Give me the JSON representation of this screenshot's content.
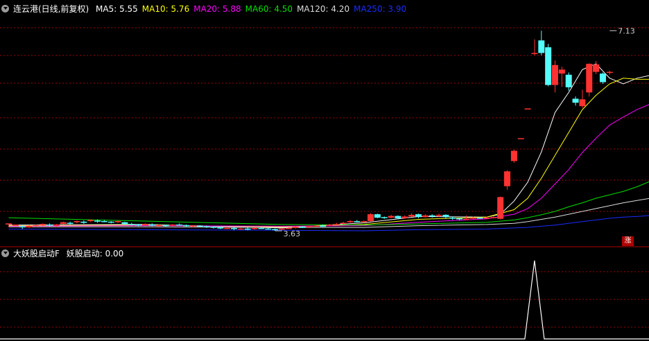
{
  "main_header": {
    "title": "连云港(日线,前复权)",
    "ma": [
      {
        "label": "MA5: 5.55",
        "color": "#ffffff"
      },
      {
        "label": "MA10: 5.76",
        "color": "#ffff00"
      },
      {
        "label": "MA20: 5.88",
        "color": "#ff00ff"
      },
      {
        "label": "MA60: 4.50",
        "color": "#00e000"
      },
      {
        "label": "MA120: 4.20",
        "color": "#dcdcdc"
      },
      {
        "label": "MA250: 3.90",
        "color": "#1a2cff"
      }
    ]
  },
  "sub_header": {
    "title": "大妖股启动F",
    "indicator": "妖股启动: 0.00"
  },
  "badge": "涨",
  "colors": {
    "up": "#ff3232",
    "down": "#54fcfc",
    "grid": "#a00000",
    "frame": "#b00000"
  },
  "chart_data": {
    "type": "candlestick",
    "ylim": [
      3.4,
      7.4
    ],
    "annotations": [
      {
        "text": "7.13",
        "x": 88,
        "y": 7.13,
        "kind": "high"
      },
      {
        "text": "3.63",
        "x": 39,
        "y": 3.63,
        "kind": "low"
      }
    ],
    "candles": [
      [
        3.74,
        3.76,
        3.72,
        3.7
      ],
      [
        3.72,
        3.74,
        3.7,
        3.69
      ],
      [
        3.71,
        3.69,
        3.73,
        3.66
      ],
      [
        3.69,
        3.72,
        3.73,
        3.68
      ],
      [
        3.72,
        3.73,
        3.74,
        3.7
      ],
      [
        3.73,
        3.75,
        3.76,
        3.71
      ],
      [
        3.74,
        3.72,
        3.76,
        3.7
      ],
      [
        3.72,
        3.74,
        3.75,
        3.7
      ],
      [
        3.75,
        3.78,
        3.79,
        3.74
      ],
      [
        3.77,
        3.76,
        3.79,
        3.74
      ],
      [
        3.78,
        3.8,
        3.81,
        3.76
      ],
      [
        3.79,
        3.77,
        3.81,
        3.75
      ],
      [
        3.8,
        3.82,
        3.83,
        3.78
      ],
      [
        3.81,
        3.79,
        3.83,
        3.77
      ],
      [
        3.8,
        3.79,
        3.82,
        3.78
      ],
      [
        3.79,
        3.78,
        3.8,
        3.76
      ],
      [
        3.78,
        3.8,
        3.81,
        3.77
      ],
      [
        3.78,
        3.75,
        3.79,
        3.73
      ],
      [
        3.75,
        3.74,
        3.77,
        3.72
      ],
      [
        3.74,
        3.73,
        3.75,
        3.71
      ],
      [
        3.73,
        3.75,
        3.76,
        3.71
      ],
      [
        3.74,
        3.72,
        3.76,
        3.71
      ],
      [
        3.72,
        3.73,
        3.74,
        3.7
      ],
      [
        3.73,
        3.72,
        3.74,
        3.7
      ],
      [
        3.72,
        3.74,
        3.75,
        3.71
      ],
      [
        3.74,
        3.73,
        3.76,
        3.72
      ],
      [
        3.73,
        3.71,
        3.74,
        3.7
      ],
      [
        3.71,
        3.72,
        3.73,
        3.69
      ],
      [
        3.72,
        3.71,
        3.73,
        3.7
      ],
      [
        3.71,
        3.7,
        3.72,
        3.68
      ],
      [
        3.7,
        3.69,
        3.71,
        3.67
      ],
      [
        3.69,
        3.67,
        3.71,
        3.66
      ],
      [
        3.68,
        3.68,
        3.7,
        3.66
      ],
      [
        3.68,
        3.66,
        3.69,
        3.64
      ],
      [
        3.66,
        3.67,
        3.68,
        3.65
      ],
      [
        3.67,
        3.65,
        3.69,
        3.64
      ],
      [
        3.66,
        3.68,
        3.69,
        3.65
      ],
      [
        3.68,
        3.67,
        3.7,
        3.66
      ],
      [
        3.67,
        3.66,
        3.68,
        3.65
      ],
      [
        3.66,
        3.65,
        3.67,
        3.63
      ],
      [
        3.65,
        3.67,
        3.68,
        3.64
      ],
      [
        3.67,
        3.68,
        3.69,
        3.66
      ],
      [
        3.68,
        3.7,
        3.71,
        3.67
      ],
      [
        3.7,
        3.69,
        3.71,
        3.68
      ],
      [
        3.69,
        3.71,
        3.72,
        3.68
      ],
      [
        3.71,
        3.72,
        3.73,
        3.7
      ],
      [
        3.72,
        3.71,
        3.74,
        3.7
      ],
      [
        3.72,
        3.74,
        3.75,
        3.71
      ],
      [
        3.74,
        3.75,
        3.77,
        3.73
      ],
      [
        3.75,
        3.77,
        3.79,
        3.74
      ],
      [
        3.78,
        3.8,
        3.82,
        3.77
      ],
      [
        3.8,
        3.79,
        3.82,
        3.78
      ],
      [
        3.79,
        3.8,
        3.81,
        3.77
      ],
      [
        3.8,
        3.92,
        3.94,
        3.79
      ],
      [
        3.92,
        3.86,
        3.93,
        3.85
      ],
      [
        3.87,
        3.86,
        3.88,
        3.84
      ],
      [
        3.86,
        3.89,
        3.91,
        3.85
      ],
      [
        3.89,
        3.85,
        3.9,
        3.83
      ],
      [
        3.85,
        3.88,
        3.9,
        3.84
      ],
      [
        3.88,
        3.91,
        3.94,
        3.87
      ],
      [
        3.92,
        3.87,
        3.93,
        3.85
      ],
      [
        3.87,
        3.9,
        3.92,
        3.86
      ],
      [
        3.9,
        3.88,
        3.92,
        3.86
      ],
      [
        3.89,
        3.91,
        3.93,
        3.87
      ],
      [
        3.91,
        3.87,
        3.92,
        3.84
      ],
      [
        3.86,
        3.85,
        3.88,
        3.82
      ],
      [
        3.85,
        3.83,
        3.86,
        3.81
      ],
      [
        3.84,
        3.84,
        3.9,
        3.82
      ],
      [
        3.84,
        3.86,
        3.88,
        3.83
      ],
      [
        3.86,
        3.85,
        3.87,
        3.84
      ],
      [
        3.85,
        3.86,
        3.88,
        3.84
      ],
      [
        3.86,
        3.87,
        3.88,
        3.85
      ],
      [
        3.84,
        4.22,
        4.23,
        3.83
      ],
      [
        4.41,
        4.67,
        4.69,
        4.35
      ],
      [
        4.85,
        5.03,
        5.05,
        4.82
      ],
      [
        5.25,
        5.25,
        5.25,
        5.25
      ],
      [
        5.77,
        5.77,
        5.77,
        5.77
      ],
      [
        6.74,
        6.74,
        6.98,
        6.7
      ],
      [
        6.96,
        6.74,
        7.13,
        6.7
      ],
      [
        6.84,
        6.18,
        6.9,
        6.16
      ],
      [
        6.18,
        6.53,
        6.61,
        6.05
      ],
      [
        6.38,
        6.45,
        6.5,
        6.15
      ],
      [
        6.36,
        6.14,
        6.4,
        6.08
      ],
      [
        5.94,
        5.87,
        5.98,
        5.82
      ],
      [
        5.81,
        5.93,
        6.1,
        5.78
      ],
      [
        6.05,
        6.55,
        6.56,
        5.98
      ],
      [
        6.41,
        6.54,
        6.6,
        6.37
      ],
      [
        6.38,
        6.23,
        6.4,
        6.2
      ],
      [
        6.4,
        6.41,
        6.43,
        6.36
      ]
    ],
    "ma": {
      "MA5": [
        [
          0,
          3.73
        ],
        [
          20,
          3.74
        ],
        [
          40,
          3.68
        ],
        [
          52,
          3.77
        ],
        [
          60,
          3.88
        ],
        [
          70,
          3.87
        ],
        [
          72,
          3.92
        ],
        [
          74,
          4.15
        ],
        [
          76,
          4.48
        ],
        [
          78,
          5.01
        ],
        [
          80,
          5.7
        ],
        [
          82,
          6.05
        ],
        [
          84,
          6.45
        ],
        [
          86,
          6.55
        ],
        [
          88,
          6.3
        ],
        [
          90,
          6.2
        ],
        [
          92,
          6.3
        ],
        [
          94,
          6.35
        ]
      ],
      "MA10": [
        [
          0,
          3.72
        ],
        [
          20,
          3.73
        ],
        [
          40,
          3.7
        ],
        [
          52,
          3.74
        ],
        [
          60,
          3.83
        ],
        [
          70,
          3.87
        ],
        [
          74,
          4.0
        ],
        [
          76,
          4.2
        ],
        [
          78,
          4.55
        ],
        [
          80,
          4.95
        ],
        [
          82,
          5.35
        ],
        [
          84,
          5.75
        ],
        [
          86,
          6.0
        ],
        [
          88,
          6.2
        ],
        [
          90,
          6.3
        ],
        [
          92,
          6.28
        ],
        [
          94,
          6.28
        ]
      ],
      "MA20": [
        [
          0,
          3.71
        ],
        [
          20,
          3.72
        ],
        [
          40,
          3.71
        ],
        [
          52,
          3.72
        ],
        [
          60,
          3.78
        ],
        [
          70,
          3.84
        ],
        [
          74,
          3.92
        ],
        [
          76,
          4.02
        ],
        [
          78,
          4.2
        ],
        [
          80,
          4.45
        ],
        [
          82,
          4.7
        ],
        [
          84,
          5.0
        ],
        [
          86,
          5.25
        ],
        [
          88,
          5.48
        ],
        [
          90,
          5.62
        ],
        [
          92,
          5.75
        ],
        [
          94,
          5.85
        ]
      ],
      "MA60": [
        [
          0,
          3.86
        ],
        [
          20,
          3.8
        ],
        [
          40,
          3.74
        ],
        [
          52,
          3.73
        ],
        [
          60,
          3.75
        ],
        [
          70,
          3.78
        ],
        [
          74,
          3.82
        ],
        [
          76,
          3.86
        ],
        [
          78,
          3.91
        ],
        [
          80,
          3.97
        ],
        [
          82,
          4.05
        ],
        [
          84,
          4.12
        ],
        [
          86,
          4.2
        ],
        [
          88,
          4.26
        ],
        [
          90,
          4.32
        ],
        [
          92,
          4.4
        ],
        [
          94,
          4.5
        ]
      ],
      "MA120": [
        [
          0,
          3.7
        ],
        [
          20,
          3.7
        ],
        [
          40,
          3.69
        ],
        [
          52,
          3.69
        ],
        [
          60,
          3.72
        ],
        [
          70,
          3.74
        ],
        [
          74,
          3.76
        ],
        [
          76,
          3.79
        ],
        [
          78,
          3.83
        ],
        [
          80,
          3.87
        ],
        [
          82,
          3.92
        ],
        [
          84,
          3.97
        ],
        [
          86,
          4.02
        ],
        [
          88,
          4.07
        ],
        [
          90,
          4.12
        ],
        [
          92,
          4.16
        ],
        [
          94,
          4.2
        ]
      ],
      "MA250": [
        [
          0,
          3.66
        ],
        [
          20,
          3.65
        ],
        [
          40,
          3.64
        ],
        [
          52,
          3.63
        ],
        [
          60,
          3.65
        ],
        [
          70,
          3.66
        ],
        [
          74,
          3.68
        ],
        [
          76,
          3.69
        ],
        [
          78,
          3.71
        ],
        [
          80,
          3.73
        ],
        [
          82,
          3.76
        ],
        [
          84,
          3.79
        ],
        [
          86,
          3.82
        ],
        [
          88,
          3.85
        ],
        [
          90,
          3.87
        ],
        [
          92,
          3.88
        ],
        [
          94,
          3.9
        ]
      ]
    },
    "indicator": {
      "name": "妖股启动",
      "ylim": [
        0,
        1
      ],
      "spike_at": 77,
      "spike_value": 1
    }
  }
}
